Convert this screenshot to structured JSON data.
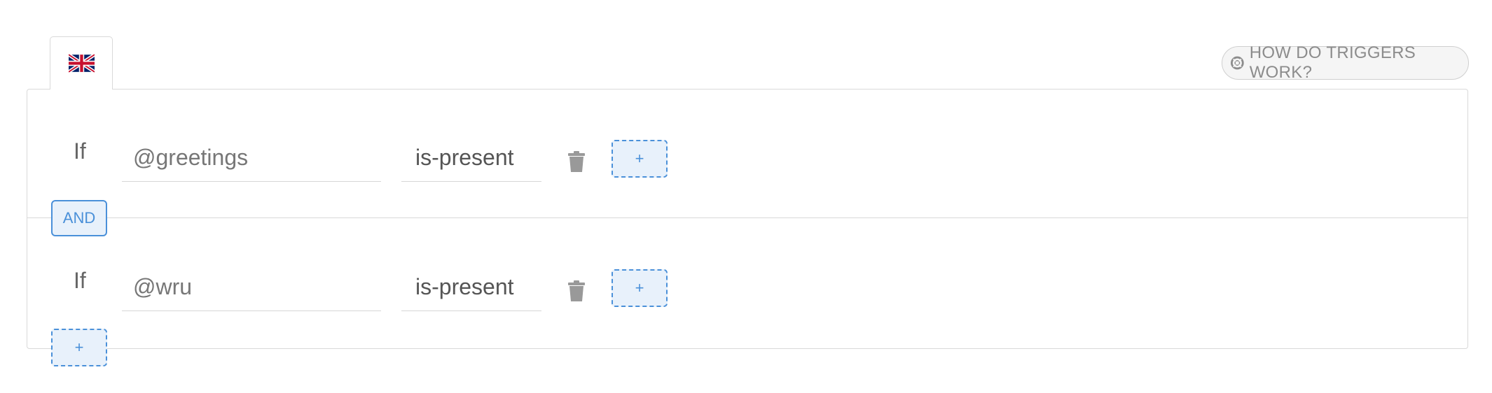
{
  "tab": {
    "flag_icon": "uk-flag-icon"
  },
  "help": {
    "label": "HOW DO TRIGGERS WORK?",
    "icon": "lifebuoy-icon"
  },
  "conditions": [
    {
      "prefix": "If",
      "variable": "@greetings",
      "operator": "is-present",
      "add_label": "+"
    },
    {
      "prefix": "If",
      "variable": "@wru",
      "operator": "is-present",
      "add_label": "+"
    }
  ],
  "connector": {
    "label": "AND"
  },
  "add_condition": {
    "label": "+"
  },
  "colors": {
    "accent": "#4a90d9",
    "accent_bg": "#e8f1fb",
    "border": "#d9d9d9",
    "muted": "#8c8c8c"
  }
}
